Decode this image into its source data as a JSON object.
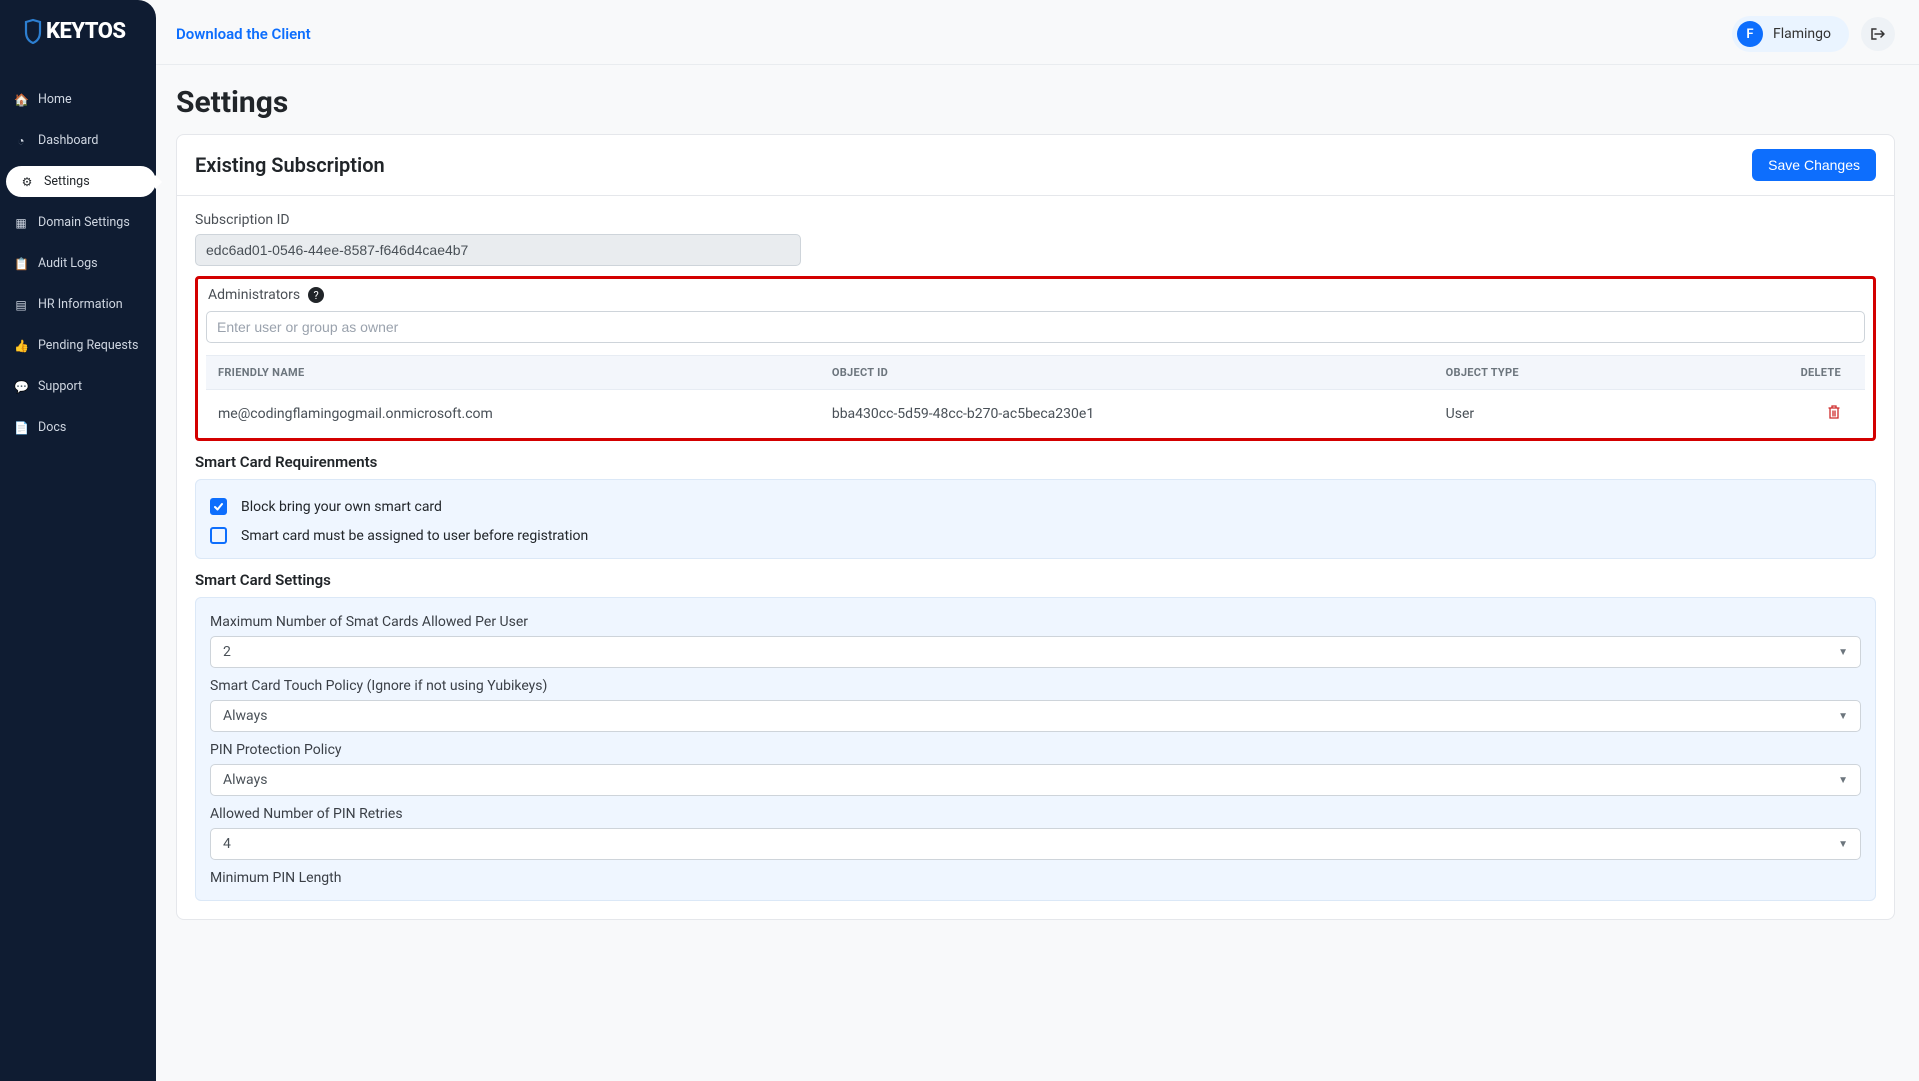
{
  "brand": "KEYTOS",
  "sidebar": {
    "items": [
      {
        "label": "Home",
        "icon": "🏠"
      },
      {
        "label": "Dashboard",
        "icon": "◔"
      },
      {
        "label": "Settings",
        "icon": "⚙"
      },
      {
        "label": "Domain Settings",
        "icon": "▦"
      },
      {
        "label": "Audit Logs",
        "icon": "📋"
      },
      {
        "label": "HR Information",
        "icon": "▤"
      },
      {
        "label": "Pending Requests",
        "icon": "👍"
      },
      {
        "label": "Support",
        "icon": "💬"
      },
      {
        "label": "Docs",
        "icon": "📄"
      }
    ],
    "activeIndex": 2
  },
  "topbar": {
    "download": "Download the Client",
    "user_initial": "F",
    "user_name": "Flamingo"
  },
  "page": {
    "title": "Settings",
    "section_title": "Existing Subscription",
    "save_label": "Save Changes",
    "subscription_label": "Subscription ID",
    "subscription_id": "edc6ad01-0546-44ee-8587-f646d4cae4b7"
  },
  "admins": {
    "label": "Administrators",
    "placeholder": "Enter user or group as owner",
    "columns": [
      "FRIENDLY NAME",
      "OBJECT ID",
      "OBJECT TYPE",
      "DELETE"
    ],
    "rows": [
      {
        "friendly_name": "me@codingflamingogmail.onmicrosoft.com",
        "object_id": "bba430cc-5d59-48cc-b270-ac5beca230e1",
        "object_type": "User"
      }
    ]
  },
  "smartcard_req": {
    "title": "Smart Card Requirenments",
    "opt1": "Block bring your own smart card",
    "opt1_checked": true,
    "opt2": "Smart card must be assigned to user before registration",
    "opt2_checked": false
  },
  "smartcard_settings": {
    "title": "Smart Card Settings",
    "fields": [
      {
        "label": "Maximum Number of Smat Cards Allowed Per User",
        "value": "2"
      },
      {
        "label": "Smart Card Touch Policy (Ignore if not using Yubikeys)",
        "value": "Always"
      },
      {
        "label": "PIN Protection Policy",
        "value": "Always"
      },
      {
        "label": "Allowed Number of PIN Retries",
        "value": "4"
      },
      {
        "label": "Minimum PIN Length",
        "value": ""
      }
    ]
  }
}
